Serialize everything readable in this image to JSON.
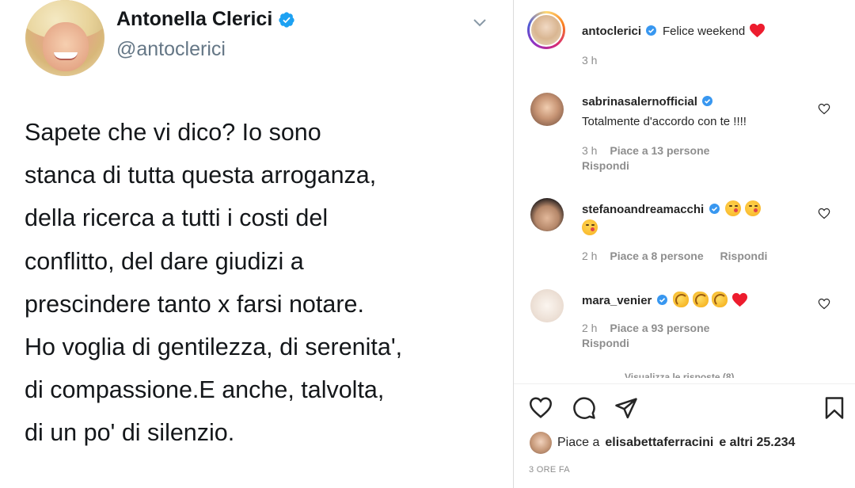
{
  "tweet": {
    "name": "Antonella Clerici",
    "handle": "@antoclerici",
    "lines": [
      "Sapete che vi dico? Io sono",
      "stanca di tutta questa arroganza,",
      "della ricerca a tutti i costi del",
      "conflitto, del dare giudizi a",
      "prescindere tanto x farsi notare.",
      "Ho voglia di gentilezza, di serenita',",
      "di compassione.E anche, talvolta,",
      "di un po' di silenzio."
    ]
  },
  "instagram": {
    "post": {
      "username": "antoclerici",
      "caption": "Felice weekend",
      "time": "3 h"
    },
    "comments": [
      {
        "username": "sabrinasalernofficial",
        "text": "Totalmente d'accordo con te !!!!",
        "time": "3 h",
        "likes": "Piace a 13 persone",
        "reply": "Rispondi"
      },
      {
        "username": "stefanoandreamacchi",
        "text": "",
        "time": "2 h",
        "likes": "Piace a 8 persone",
        "reply": "Rispondi"
      },
      {
        "username": "mara_venier",
        "text": "",
        "time": "2 h",
        "likes": "Piace a 93 persone",
        "reply": "Rispondi"
      }
    ],
    "view_replies": "Visualizza le risposte (8)",
    "likes_summary": {
      "prefix": "Piace a",
      "user": "elisabettaferracini",
      "suffix": "e altri 25.234"
    },
    "posted_ago": "3 ORE FA"
  },
  "colors": {
    "twitter_verified": "#1da1f2",
    "instagram_verified": "#3897f0",
    "muted_text": "#8e8e8e",
    "handle_gray": "#657786",
    "heart_red": "#ed1c2e"
  }
}
